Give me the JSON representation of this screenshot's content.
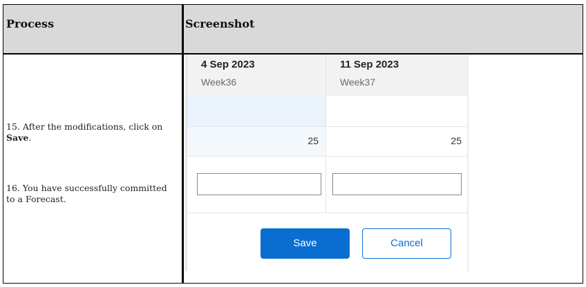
{
  "table": {
    "header": {
      "process": "Process",
      "screenshot": "Screenshot"
    },
    "steps": {
      "s15_prefix": "15. After the modifications, click on ",
      "s15_bold": "Save",
      "s15_suffix": ".",
      "s16": "16. You have successfully committed to a Forecast."
    }
  },
  "screenshot": {
    "columns": [
      {
        "date": "4 Sep 2023",
        "week": "Week36",
        "value": "25"
      },
      {
        "date": "11 Sep 2023",
        "week": "Week37",
        "value": "25"
      }
    ],
    "inputs": [
      {
        "value": "",
        "placeholder": ""
      },
      {
        "value": "",
        "placeholder": ""
      }
    ],
    "buttons": {
      "save": "Save",
      "cancel": "Cancel"
    },
    "colors": {
      "accent": "#0a6ed1",
      "selected_cell": "#eaf2fb"
    }
  }
}
